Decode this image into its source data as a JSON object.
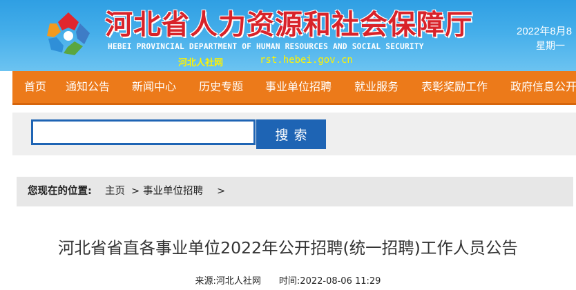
{
  "header": {
    "title": "河北省人力资源和社会保障厅",
    "subtitle": "HEBEI PROVINCIAL DEPARTMENT OF HUMAN RESOURCES AND SOCIAL SECURITY",
    "site_short": "河北人社网",
    "domain": "rst.hebei.gov.cn",
    "date": "2022年8月8",
    "weekday": "星期一",
    "logo_icon": "star-petal-logo-icon"
  },
  "nav": {
    "items": [
      {
        "label": "首页"
      },
      {
        "label": "通知公告"
      },
      {
        "label": "新闻中心"
      },
      {
        "label": "历史专题"
      },
      {
        "label": "事业单位招聘"
      },
      {
        "label": "就业服务"
      },
      {
        "label": "表彰奖励工作"
      },
      {
        "label": "政府信息公开"
      }
    ]
  },
  "search": {
    "value": "",
    "placeholder": "",
    "button_label": "搜索"
  },
  "breadcrumb": {
    "lead": "您现在的位置:",
    "items": [
      {
        "label": "主页"
      },
      {
        "label": "事业单位招聘"
      }
    ],
    "separator": ">"
  },
  "article": {
    "title": "河北省省直各事业单位2022年公开招聘(统一招聘)工作人员公告",
    "source": "来源:河北人社网",
    "time": "时间:2022-08-06 11:29"
  },
  "colors": {
    "header_blue": "#44aeea",
    "title_red": "#d8232a",
    "nav_orange": "#ec7a1a",
    "search_blue": "#1e64b4",
    "accent_yellow": "#fff200"
  }
}
